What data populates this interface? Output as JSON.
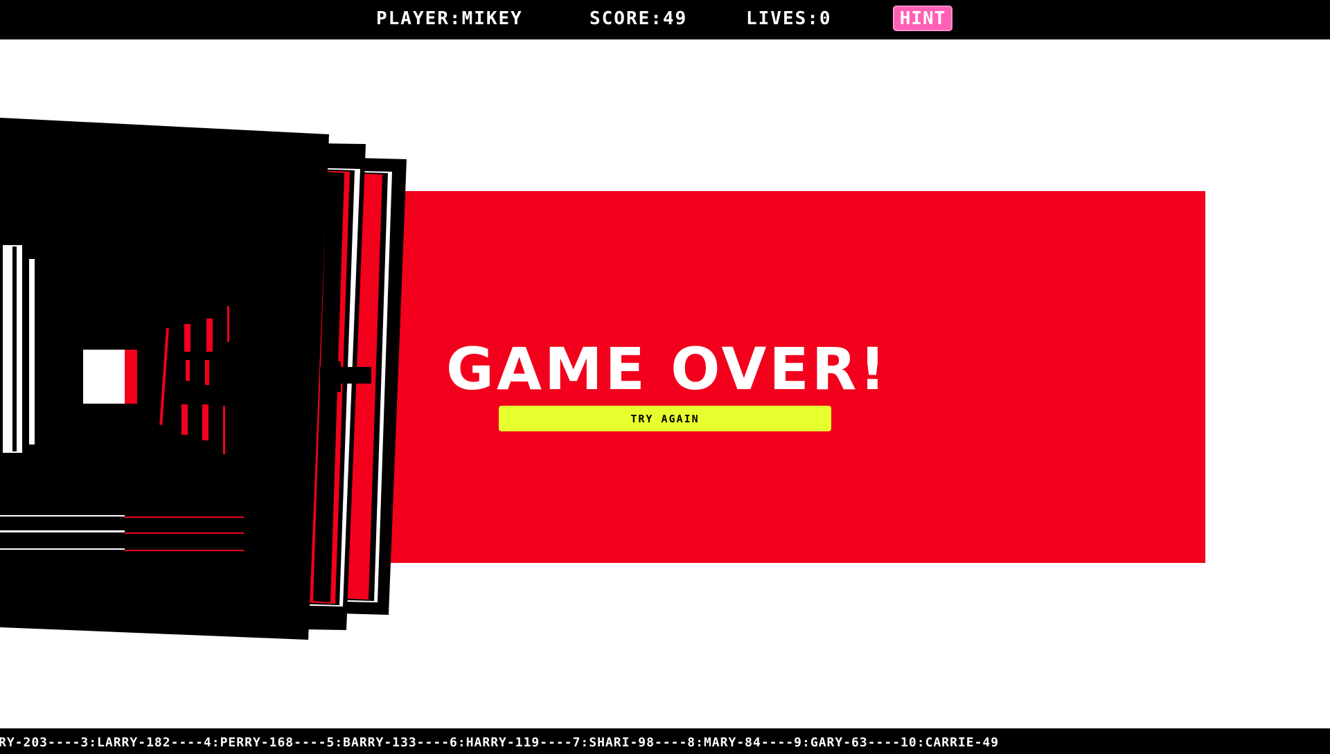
{
  "hud": {
    "player": "PLAYER:MIKEY",
    "score": "SCORE:49",
    "lives": "LIVES:0",
    "hint_label": "HINT"
  },
  "game_over": {
    "title": "GAME OVER!",
    "try_again_label": "TRY AGAIN"
  },
  "leaderboard_ticker": "RY-203----3:LARRY-182----4:PERRY-168----5:BARRY-133----6:HARRY-119----7:SHARI-98----8:MARY-84----9:GARY-63----10:CARRIE-49",
  "colors": {
    "accent_red": "#f2001c",
    "hint_pink": "#ff5fb4",
    "button_yellow": "#e6ff2e",
    "bar_black": "#000000"
  }
}
